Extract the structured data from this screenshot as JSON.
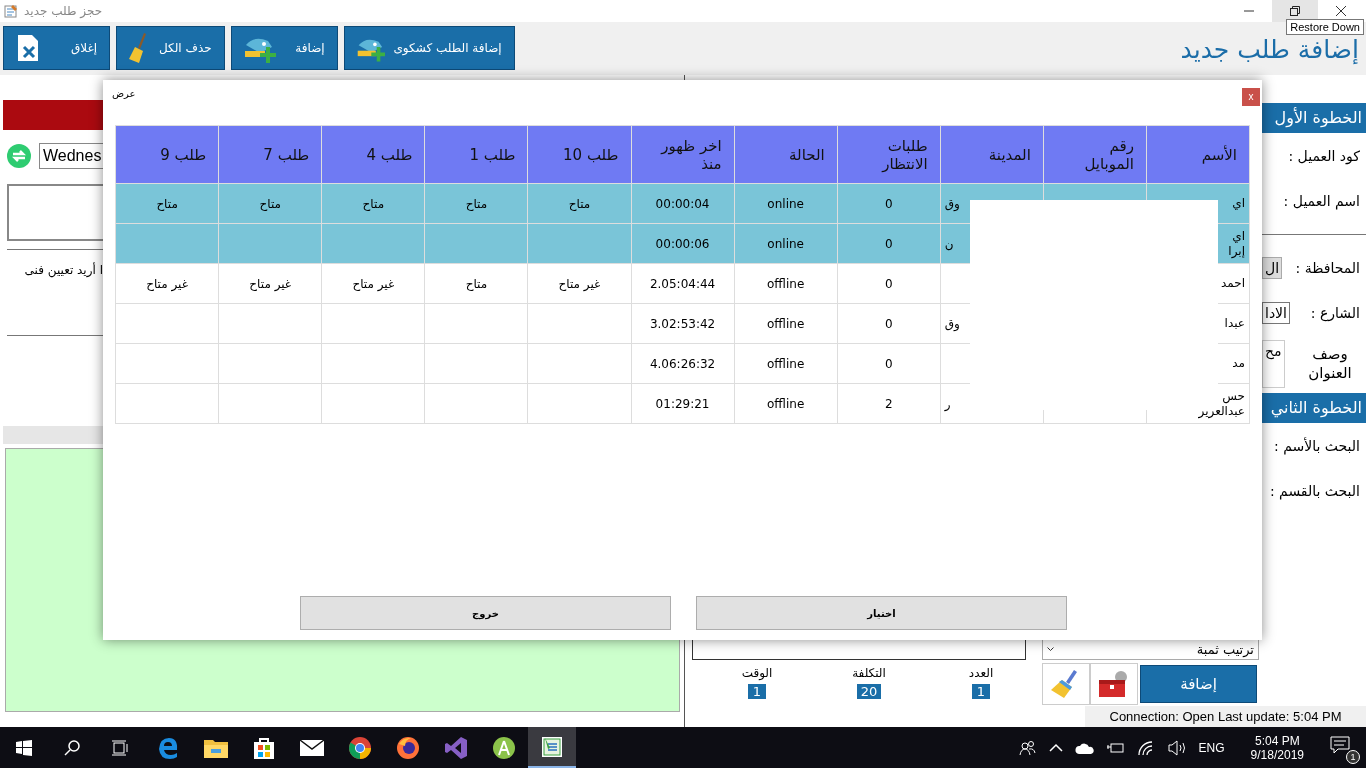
{
  "window": {
    "title": "حجز طلب جديد",
    "tooltip": "Restore Down"
  },
  "toolbar": {
    "page_title": "إضافة طلب جديد",
    "buttons": [
      {
        "label": "إضافة الطلب كشكوى",
        "kind": "complaint"
      },
      {
        "label": "إضافة",
        "kind": "add"
      },
      {
        "label": "حذف الكل",
        "kind": "clear"
      },
      {
        "label": "إغلاق",
        "kind": "close"
      }
    ]
  },
  "left_panel": {
    "date_field": {
      "value": "Wednes"
    },
    "note": "ا أريد تعيين فنى"
  },
  "right_strip": {
    "items": [
      {
        "kind": "header",
        "label": "الخطوة الأول"
      },
      {
        "kind": "label",
        "label": "كود العميل :"
      },
      {
        "kind": "label",
        "label": "اسم العميل :"
      },
      {
        "kind": "divider"
      },
      {
        "kind": "combo",
        "label": "المحافظة :",
        "value": "ال"
      },
      {
        "kind": "field",
        "label": "الشارع :",
        "value": "الادا"
      },
      {
        "kind": "area",
        "label": "وصف العنوان",
        "value": "مح"
      },
      {
        "kind": "header",
        "label": "الخطوة الثاني"
      },
      {
        "kind": "label",
        "label": "البحث بالأسم :"
      },
      {
        "kind": "label",
        "label": "البحث بالقسم :"
      }
    ]
  },
  "order_panel": {
    "sort_dropdown": {
      "value": "ترتيب ثمبة"
    },
    "counters": [
      {
        "label": "العدد",
        "value": "1"
      },
      {
        "label": "التكلفة",
        "value": "20"
      },
      {
        "label": "الوقت",
        "value": "1"
      }
    ],
    "add_button": "إضافة"
  },
  "status_bar": "Connection: Open Last update: 5:04 PM",
  "dialog": {
    "title": "عرض",
    "close": "x",
    "columns": [
      "الأسم",
      "رقم الموبايل",
      "المدينة",
      "طلبات الانتظار",
      "الحالة",
      "اخر ظهور منذ",
      "طلب 10",
      "طلب 1",
      "طلب 4",
      "طلب 7",
      "طلب 9"
    ],
    "rows": [
      {
        "name_lines": [
          "اي"
        ],
        "city": "وق",
        "waiting": "0",
        "status": "online",
        "last_seen": "00:00:04",
        "orders": [
          "متاح",
          "متاح",
          "متاح",
          "متاح",
          "متاح"
        ],
        "highlighted": true
      },
      {
        "name_lines": [
          "اي",
          "إبرا"
        ],
        "city": "ن",
        "waiting": "0",
        "status": "online",
        "last_seen": "00:00:06",
        "highlighted": true
      },
      {
        "name_lines": [
          "احمد"
        ],
        "waiting": "0",
        "status": "offline",
        "last_seen": "2.05:04:44",
        "orders": [
          "غير متاح",
          "متاح",
          "غير متاح",
          "غير متاح",
          "غير متاح"
        ],
        "highlighted": false
      },
      {
        "name_lines": [
          "عبدا"
        ],
        "city": "وق",
        "waiting": "0",
        "status": "offline",
        "last_seen": "3.02:53:42",
        "highlighted": false
      },
      {
        "name_lines": [
          "مد"
        ],
        "waiting": "0",
        "status": "offline",
        "last_seen": "4.06:26:32",
        "highlighted": false
      },
      {
        "name_lines": [
          "حس",
          "عبدالعزيز"
        ],
        "city": "ر",
        "waiting": "2",
        "status": "offline",
        "last_seen": "01:29:21",
        "highlighted": false
      }
    ],
    "buttons": [
      "اختيار",
      "خروج"
    ]
  },
  "taskbar": {
    "language": "ENG",
    "time": "5:04 PM",
    "date": "9/18/2019",
    "notification_count": "1"
  }
}
